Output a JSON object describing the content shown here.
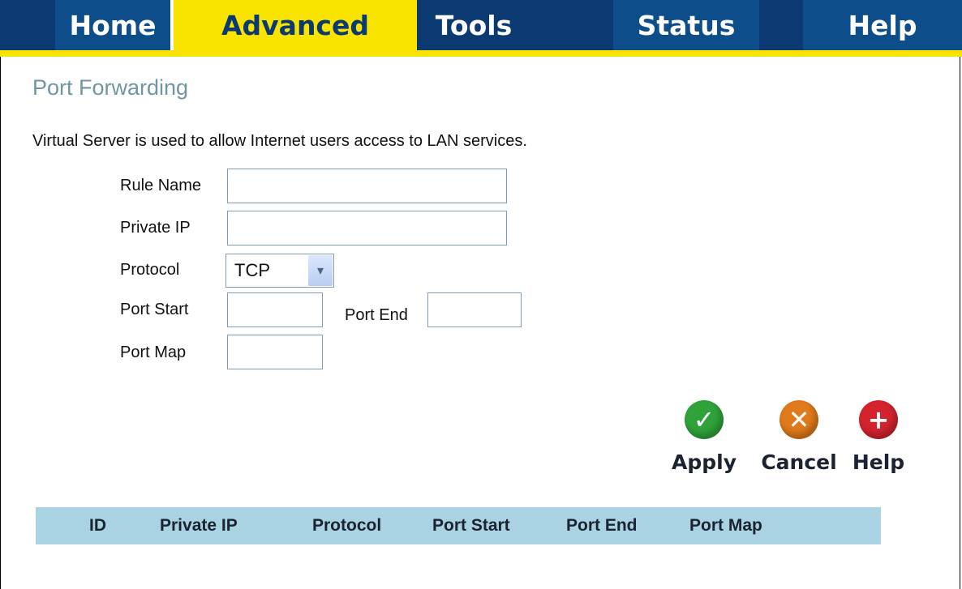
{
  "tabs": [
    {
      "label": "Home"
    },
    {
      "label": "Advanced"
    },
    {
      "label": "Tools"
    },
    {
      "label": "Status"
    },
    {
      "label": "Help"
    }
  ],
  "active_tab": "Advanced",
  "page_title": "Port Forwarding",
  "description": "Virtual Server is used to allow Internet users access to LAN services.",
  "form": {
    "rule_name_label": "Rule Name",
    "rule_name_value": "",
    "private_ip_label": "Private IP",
    "private_ip_value": "",
    "protocol_label": "Protocol",
    "protocol_value": "TCP",
    "port_start_label": "Port Start",
    "port_start_value": "",
    "port_end_label": "Port End",
    "port_end_value": "",
    "port_map_label": "Port Map",
    "port_map_value": ""
  },
  "actions": {
    "apply": "Apply",
    "cancel": "Cancel",
    "help": "Help"
  },
  "table": {
    "columns": [
      "ID",
      "Private IP",
      "Protocol",
      "Port Start",
      "Port End",
      "Port Map"
    ],
    "rows": []
  },
  "colors": {
    "tab_bar": "#0b3a72",
    "tab_active": "#f9e400",
    "title": "#6f96a3",
    "table_header": "#a9d2e2",
    "apply": "#2fa33a",
    "cancel": "#e07a1a",
    "help": "#d4232c"
  },
  "icons": {
    "apply": "check-icon",
    "cancel": "x-icon",
    "help": "plus-icon"
  }
}
